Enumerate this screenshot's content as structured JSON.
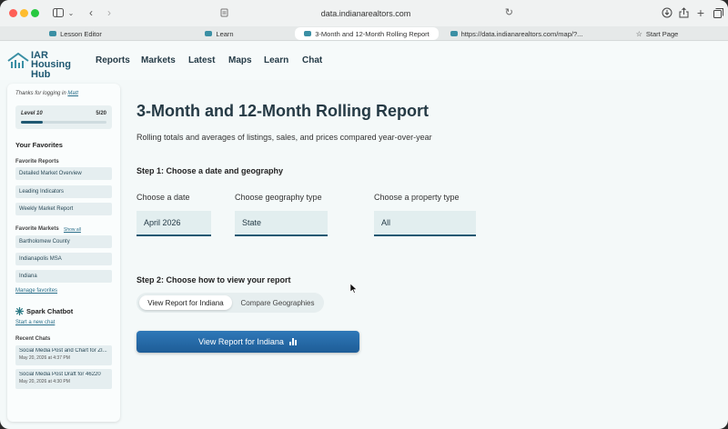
{
  "browser": {
    "url": "data.indianarealtors.com",
    "tabs": [
      {
        "label": "Lesson Editor",
        "icon": "site-favicon"
      },
      {
        "label": "Learn",
        "icon": "site-favicon"
      },
      {
        "label": "3-Month and 12-Month Rolling Report",
        "icon": "site-favicon",
        "active": true
      },
      {
        "label": "https://data.indianarealtors.com/map/?...",
        "icon": "site-favicon"
      },
      {
        "label": "Start Page",
        "icon": "star-icon"
      }
    ]
  },
  "site": {
    "logo_line1": "IAR",
    "logo_line2": "Housing Hub",
    "nav": [
      "Reports",
      "Markets",
      "Latest",
      "Maps",
      "Learn",
      "Chat"
    ]
  },
  "sidebar": {
    "thanks_prefix": "Thanks for logging in ",
    "user": "Matt",
    "level_label": "Level 10",
    "level_count": "5/20",
    "level_progress": 0.25,
    "favorites_title": "Your Favorites",
    "favorite_reports_label": "Favorite Reports",
    "favorite_reports": [
      "Detailed Market Overview",
      "Leading Indicators",
      "Weekly Market Report"
    ],
    "favorite_markets_label": "Favorite Markets",
    "show_all": "Show all",
    "favorite_markets": [
      "Bartholomew County",
      "Indianapolis MSA",
      "Indiana"
    ],
    "manage_favorites": "Manage favorites",
    "chatbot_title": "Spark Chatbot",
    "new_chat": "Start a new chat",
    "recent_chats_label": "Recent Chats",
    "recent_chats": [
      {
        "title": "Social Media Post and Chart for ZI...",
        "date": "May 20, 2026 at 4:37 PM"
      },
      {
        "title": "Social Media Post Draft for 46220",
        "date": "May 20, 2026 at 4:30 PM"
      }
    ]
  },
  "main": {
    "title": "3-Month and 12-Month Rolling Report",
    "subtitle": "Rolling totals and averages of listings, sales, and prices compared year-over-year",
    "step1": "Step 1: Choose a date and geography",
    "date_label": "Choose a date",
    "date_value": "April 2026",
    "geo_label": "Choose geography type",
    "geo_value": "State",
    "prop_label": "Choose a property type",
    "prop_value": "All",
    "step2": "Step 2: Choose how to view your report",
    "toggle_option_1": "View Report for Indiana",
    "toggle_option_2": "Compare Geographies",
    "cta": "View Report for Indiana"
  }
}
